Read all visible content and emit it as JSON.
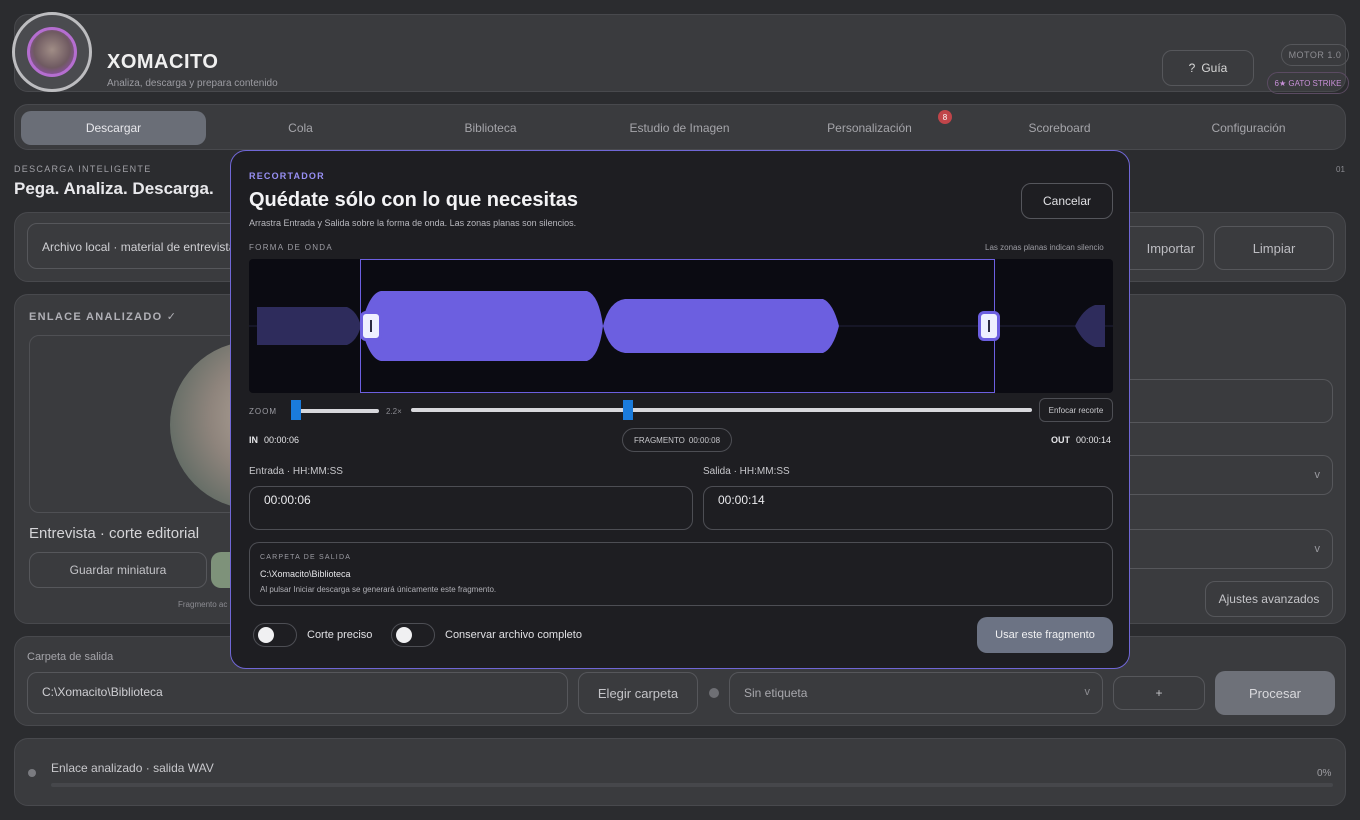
{
  "header": {
    "title": "XOMACITO",
    "subtitle": "Analiza, descarga y prepara contenido",
    "guide_label": "Guía",
    "guide_icon": "?",
    "motor_badge": "MOTOR 1.0",
    "gato_badge": "6★ GATO STRIKE"
  },
  "tabs": [
    {
      "label": "Descargar",
      "active": true
    },
    {
      "label": "Cola"
    },
    {
      "label": "Biblioteca"
    },
    {
      "label": "Estudio de Imagen"
    },
    {
      "label": "Personalización",
      "badge": "8"
    },
    {
      "label": "Scoreboard"
    },
    {
      "label": "Configuración"
    }
  ],
  "section": {
    "eyebrow": "DESCARGA INTELIGENTE",
    "title": "Pega. Analiza. Descarga.",
    "number": "01"
  },
  "input": {
    "value": "Archivo local · material de entrevista",
    "import_label": "Importar",
    "clear_label": "Limpiar"
  },
  "analyzed": {
    "label": "ENLACE ANALIZADO ✓",
    "clip_title": "Entrevista · corte editorial",
    "save_thumb_label": "Guardar miniatura",
    "fragment_note": "Fragmento ac",
    "advanced_label": "Ajustes avanzados",
    "chevron": "v"
  },
  "output": {
    "label": "Carpeta de salida",
    "path": "C:\\Xomacito\\Biblioteca",
    "choose_label": "Elegir carpeta",
    "tag_value": "Sin etiqueta",
    "add_tag_label": "+",
    "process_label": "Procesar",
    "chevron": "v"
  },
  "status": {
    "text": "Enlace analizado · salida WAV",
    "percent": "0%",
    "progress": 0
  },
  "modal": {
    "eyebrow": "RECORTADOR",
    "title": "Quédate sólo con lo que necesitas",
    "subtitle": "Arrastra Entrada y Salida sobre la forma de onda. Las zonas planas son silencios.",
    "cancel_label": "Cancelar",
    "waveform_label": "FORMA DE ONDA",
    "waveform_hint": "Las zonas planas indican silencio",
    "zoom_label": "ZOOM",
    "zoom_value": "2.2×",
    "focus_label": "Enfocar recorte",
    "in_label": "IN",
    "in_time": "00:00:06",
    "fragment_label": "FRAGMENTO",
    "fragment_time": "00:00:08",
    "out_label": "OUT",
    "out_time": "00:00:14",
    "entry_label": "Entrada · HH:MM:SS",
    "entry_value": "00:00:06",
    "exit_label": "Salida · HH:MM:SS",
    "exit_value": "00:00:14",
    "folder_label": "CARPETA DE SALIDA",
    "folder_path": "C:\\Xomacito\\Biblioteca",
    "folder_note": "Al pulsar Iniciar descarga se generará únicamente este fragmento.",
    "precise_label": "Corte preciso",
    "keep_label": "Conservar archivo completo",
    "use_label": "Usar este fragmento"
  },
  "colors": {
    "accent": "#6c5fe0",
    "waveform_active": "#6c5fe0",
    "waveform_inactive": "#2e2c5c",
    "slider": "#1a7bdc"
  }
}
